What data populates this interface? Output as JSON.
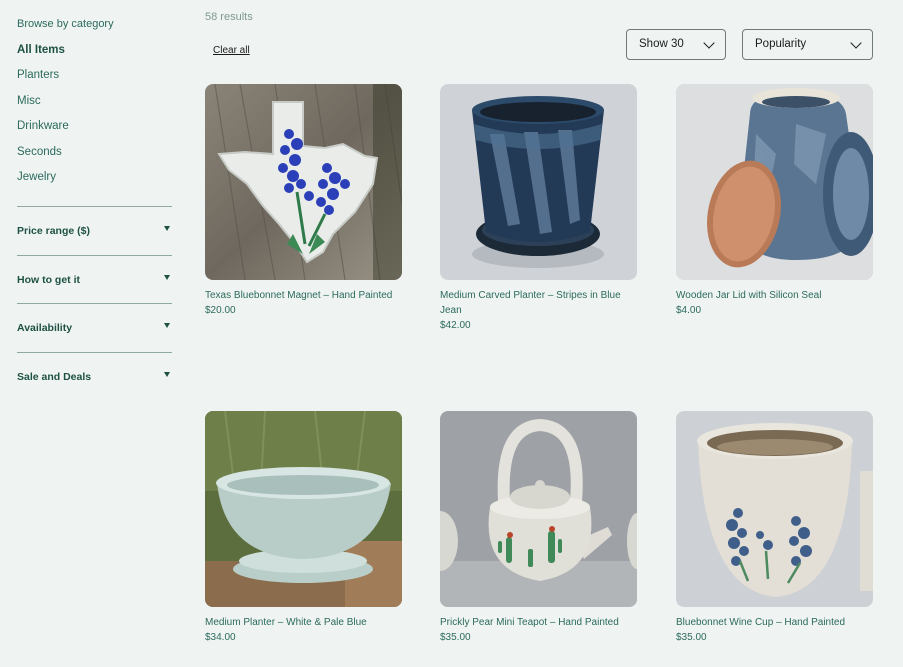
{
  "sidebar": {
    "browse_title": "Browse by category",
    "categories": [
      "All Items",
      "Planters",
      "Misc",
      "Drinkware",
      "Seconds",
      "Jewelry"
    ],
    "filters": [
      "Price range ($)",
      "How to get it",
      "Availability",
      "Sale and Deals"
    ]
  },
  "toolbar": {
    "results": "58 results",
    "clear_all": "Clear all",
    "show_select": "Show 30",
    "sort_select": "Popularity"
  },
  "products": [
    {
      "name": "Texas Bluebonnet Magnet – Hand Painted",
      "price": "$20.00"
    },
    {
      "name": "Medium Carved Planter – Stripes in Blue Jean",
      "price": "$42.00"
    },
    {
      "name": "Wooden Jar Lid with Silicon Seal",
      "price": "$4.00"
    },
    {
      "name": "Medium Planter – White & Pale Blue",
      "price": "$34.00"
    },
    {
      "name": "Prickly Pear Mini Teapot – Hand Painted",
      "price": "$35.00"
    },
    {
      "name": "Bluebonnet Wine Cup – Hand Painted",
      "price": "$35.00"
    }
  ],
  "colors": {
    "background": "#eff4f3",
    "text": "#2c6a5b",
    "accent": "#1e5143"
  }
}
